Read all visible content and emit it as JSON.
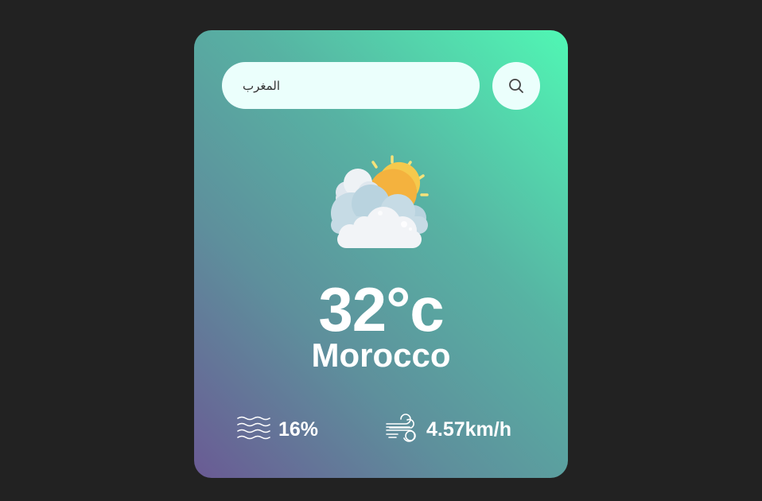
{
  "search": {
    "value": "المغرب",
    "placeholder": "",
    "button_icon": "search-icon"
  },
  "weather": {
    "icon": "partly-cloudy-sun-icon",
    "temperature": "32°c",
    "city": "Morocco"
  },
  "details": {
    "humidity": {
      "icon": "humidity-waves-icon",
      "value": "16%"
    },
    "wind": {
      "icon": "wind-icon",
      "value": "4.57km/h"
    }
  },
  "colors": {
    "background": "#222222",
    "card_gradient_start": "#6a5a94",
    "card_gradient_end": "#50f7b4",
    "input_background": "#ebfffc",
    "text": "#ffffff"
  }
}
